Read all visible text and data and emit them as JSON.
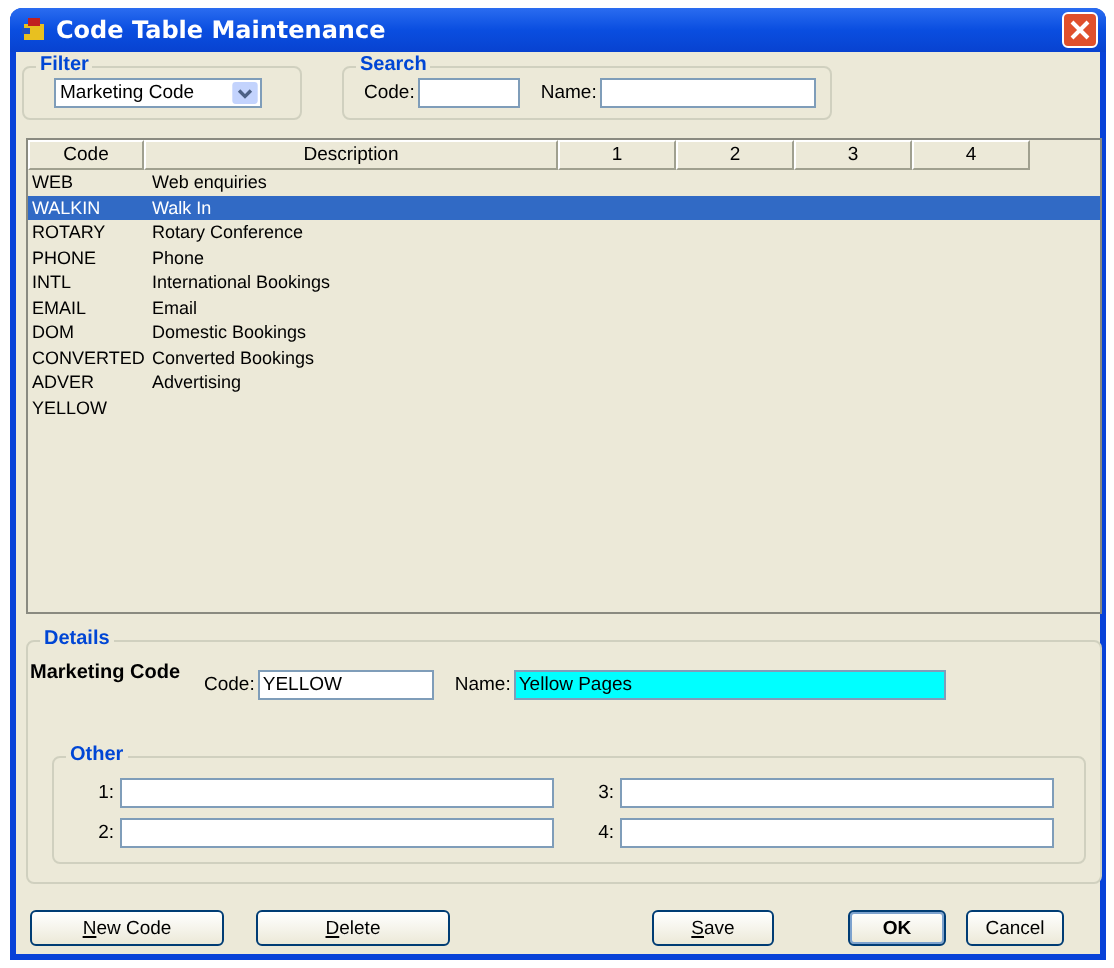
{
  "window": {
    "title": "Code Table Maintenance"
  },
  "filter": {
    "legend": "Filter",
    "value": "Marketing Code"
  },
  "search": {
    "legend": "Search",
    "code_label": "Code:",
    "name_label": "Name:"
  },
  "table": {
    "columns": [
      "Code",
      "Description",
      "1",
      "2",
      "3",
      "4"
    ],
    "rows": [
      {
        "code": "WEB",
        "description": "Web enquiries",
        "selected": false
      },
      {
        "code": "WALKIN",
        "description": "Walk In",
        "selected": true
      },
      {
        "code": "ROTARY",
        "description": "Rotary Conference",
        "selected": false
      },
      {
        "code": "PHONE",
        "description": "Phone",
        "selected": false
      },
      {
        "code": "INTL",
        "description": "International Bookings",
        "selected": false
      },
      {
        "code": "EMAIL",
        "description": "Email",
        "selected": false
      },
      {
        "code": "DOM",
        "description": "Domestic Bookings",
        "selected": false
      },
      {
        "code": "CONVERTED",
        "description": "Converted Bookings",
        "selected": false
      },
      {
        "code": "ADVER",
        "description": "Advertising",
        "selected": false
      },
      {
        "code": "YELLOW",
        "description": "",
        "selected": false
      }
    ]
  },
  "details": {
    "legend": "Details",
    "heading": "Marketing Code",
    "code_label": "Code:",
    "code_value": "YELLOW",
    "name_label": "Name:",
    "name_value": "Yellow Pages",
    "other": {
      "legend": "Other",
      "fields": [
        {
          "label": "1:"
        },
        {
          "label": "3:"
        },
        {
          "label": "2:"
        },
        {
          "label": "4:"
        }
      ]
    }
  },
  "buttons": [
    {
      "label": "New Code",
      "mnemonic": true,
      "default": false
    },
    {
      "label": "Delete",
      "mnemonic": true,
      "default": false
    },
    {
      "label": "Save",
      "mnemonic": true,
      "default": false
    },
    {
      "label": "OK",
      "mnemonic": false,
      "default": true
    },
    {
      "label": "Cancel",
      "mnemonic": false,
      "default": false
    }
  ]
}
